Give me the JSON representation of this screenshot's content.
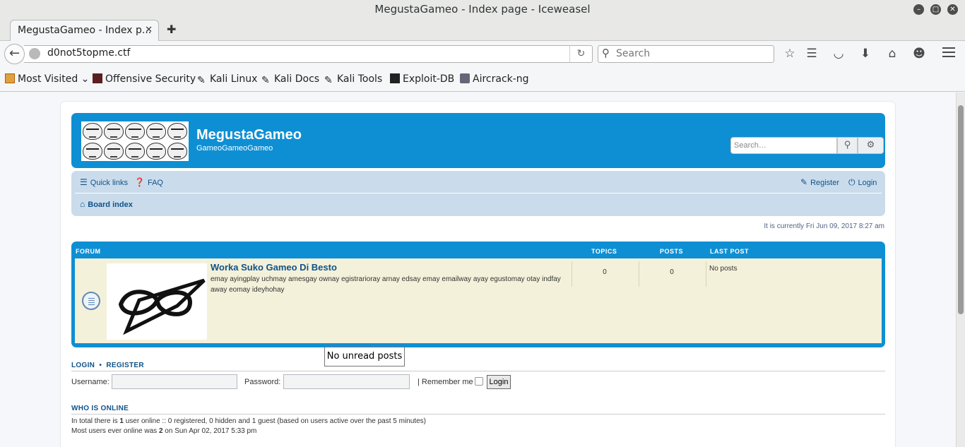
{
  "window": {
    "title": "MegustaGameo - Index page - Iceweasel"
  },
  "tab": {
    "label": "MegustaGameo - Index p...",
    "close": "✕"
  },
  "urlbar": {
    "url": "d0not5topme.ctf"
  },
  "searchbar": {
    "placeholder": "Search"
  },
  "bookmarks": [
    {
      "label": "Most Visited",
      "icon": "most-visited-icon"
    },
    {
      "label": "Offensive Security",
      "icon": "offsec-icon"
    },
    {
      "label": "Kali Linux",
      "icon": "kali-icon"
    },
    {
      "label": "Kali Docs",
      "icon": "kali-icon"
    },
    {
      "label": "Kali Tools",
      "icon": "kali-icon"
    },
    {
      "label": "Exploit-DB",
      "icon": "exploitdb-icon"
    },
    {
      "label": "Aircrack-ng",
      "icon": "aircrack-icon"
    }
  ],
  "site": {
    "title": "MegustaGameo",
    "description": "GameoGameoGameo",
    "search_placeholder": "Search…"
  },
  "nav": {
    "quick_links": "Quick links",
    "faq": "FAQ",
    "register": "Register",
    "login": "Login",
    "breadcrumb": "Board index"
  },
  "datetime": "It is currently Fri Jun 09, 2017 8:27 am",
  "forum_table": {
    "headers": {
      "forum": "FORUM",
      "topics": "TOPICS",
      "posts": "POSTS",
      "last_post": "LAST POST"
    },
    "rows": [
      {
        "title": "Worka Suko Gameo Di Besto",
        "description": "emay ayingplay uchmay amesgay ownay egistrarioray arnay edsay emay emailway ayay egustomay otay indfay away eomay ideyhohay",
        "topics": "0",
        "posts": "0",
        "last_post": "No posts"
      }
    ]
  },
  "tooltip": "No unread posts",
  "login_section": {
    "heading": "LOGIN",
    "bullet": "•",
    "heading2": "REGISTER",
    "username_label": "Username:",
    "password_label": "Password:",
    "remember_label": "| Remember me",
    "button": "Login"
  },
  "online": {
    "heading": "WHO IS ONLINE",
    "line1_a": "In total there is ",
    "line1_num": "1",
    "line1_b": " user online :: 0 registered, 0 hidden and 1 guest (based on users active over the past 5 minutes)",
    "line2_a": "Most users ever online was ",
    "line2_num": "2",
    "line2_b": " on Sun Apr 02, 2017 5:33 pm"
  }
}
